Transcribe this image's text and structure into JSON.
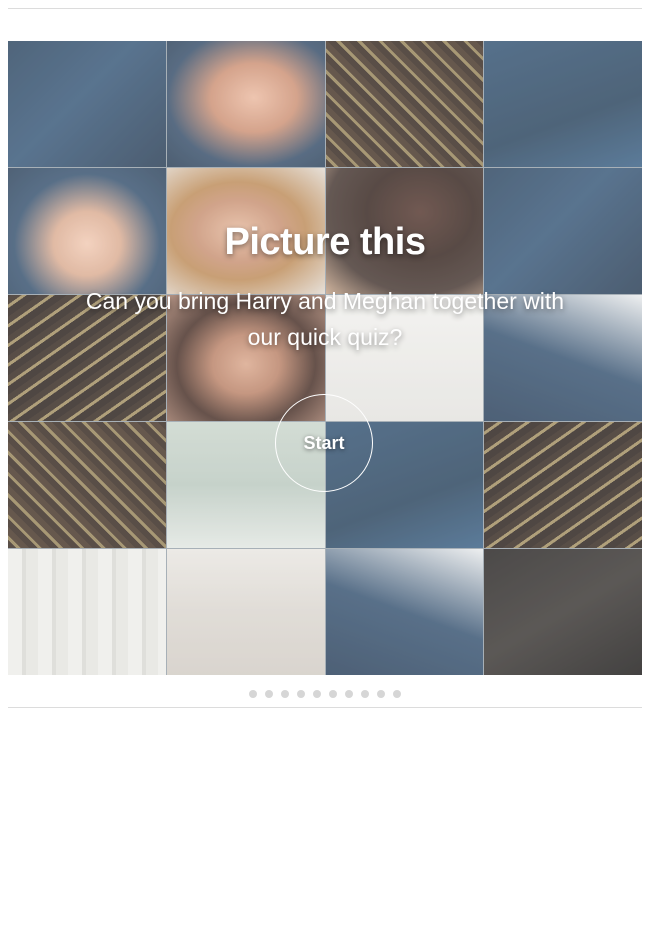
{
  "quiz": {
    "title": "Picture this",
    "subtitle": "Can you bring Harry and Meghan together with our quick quiz?",
    "start_label": "Start"
  },
  "pagination": {
    "total": 10,
    "icon": "dot-indicator"
  },
  "colors": {
    "divider": "#dcdcdc",
    "dot": "#d6d6d6",
    "overlay_text": "#ffffff"
  }
}
